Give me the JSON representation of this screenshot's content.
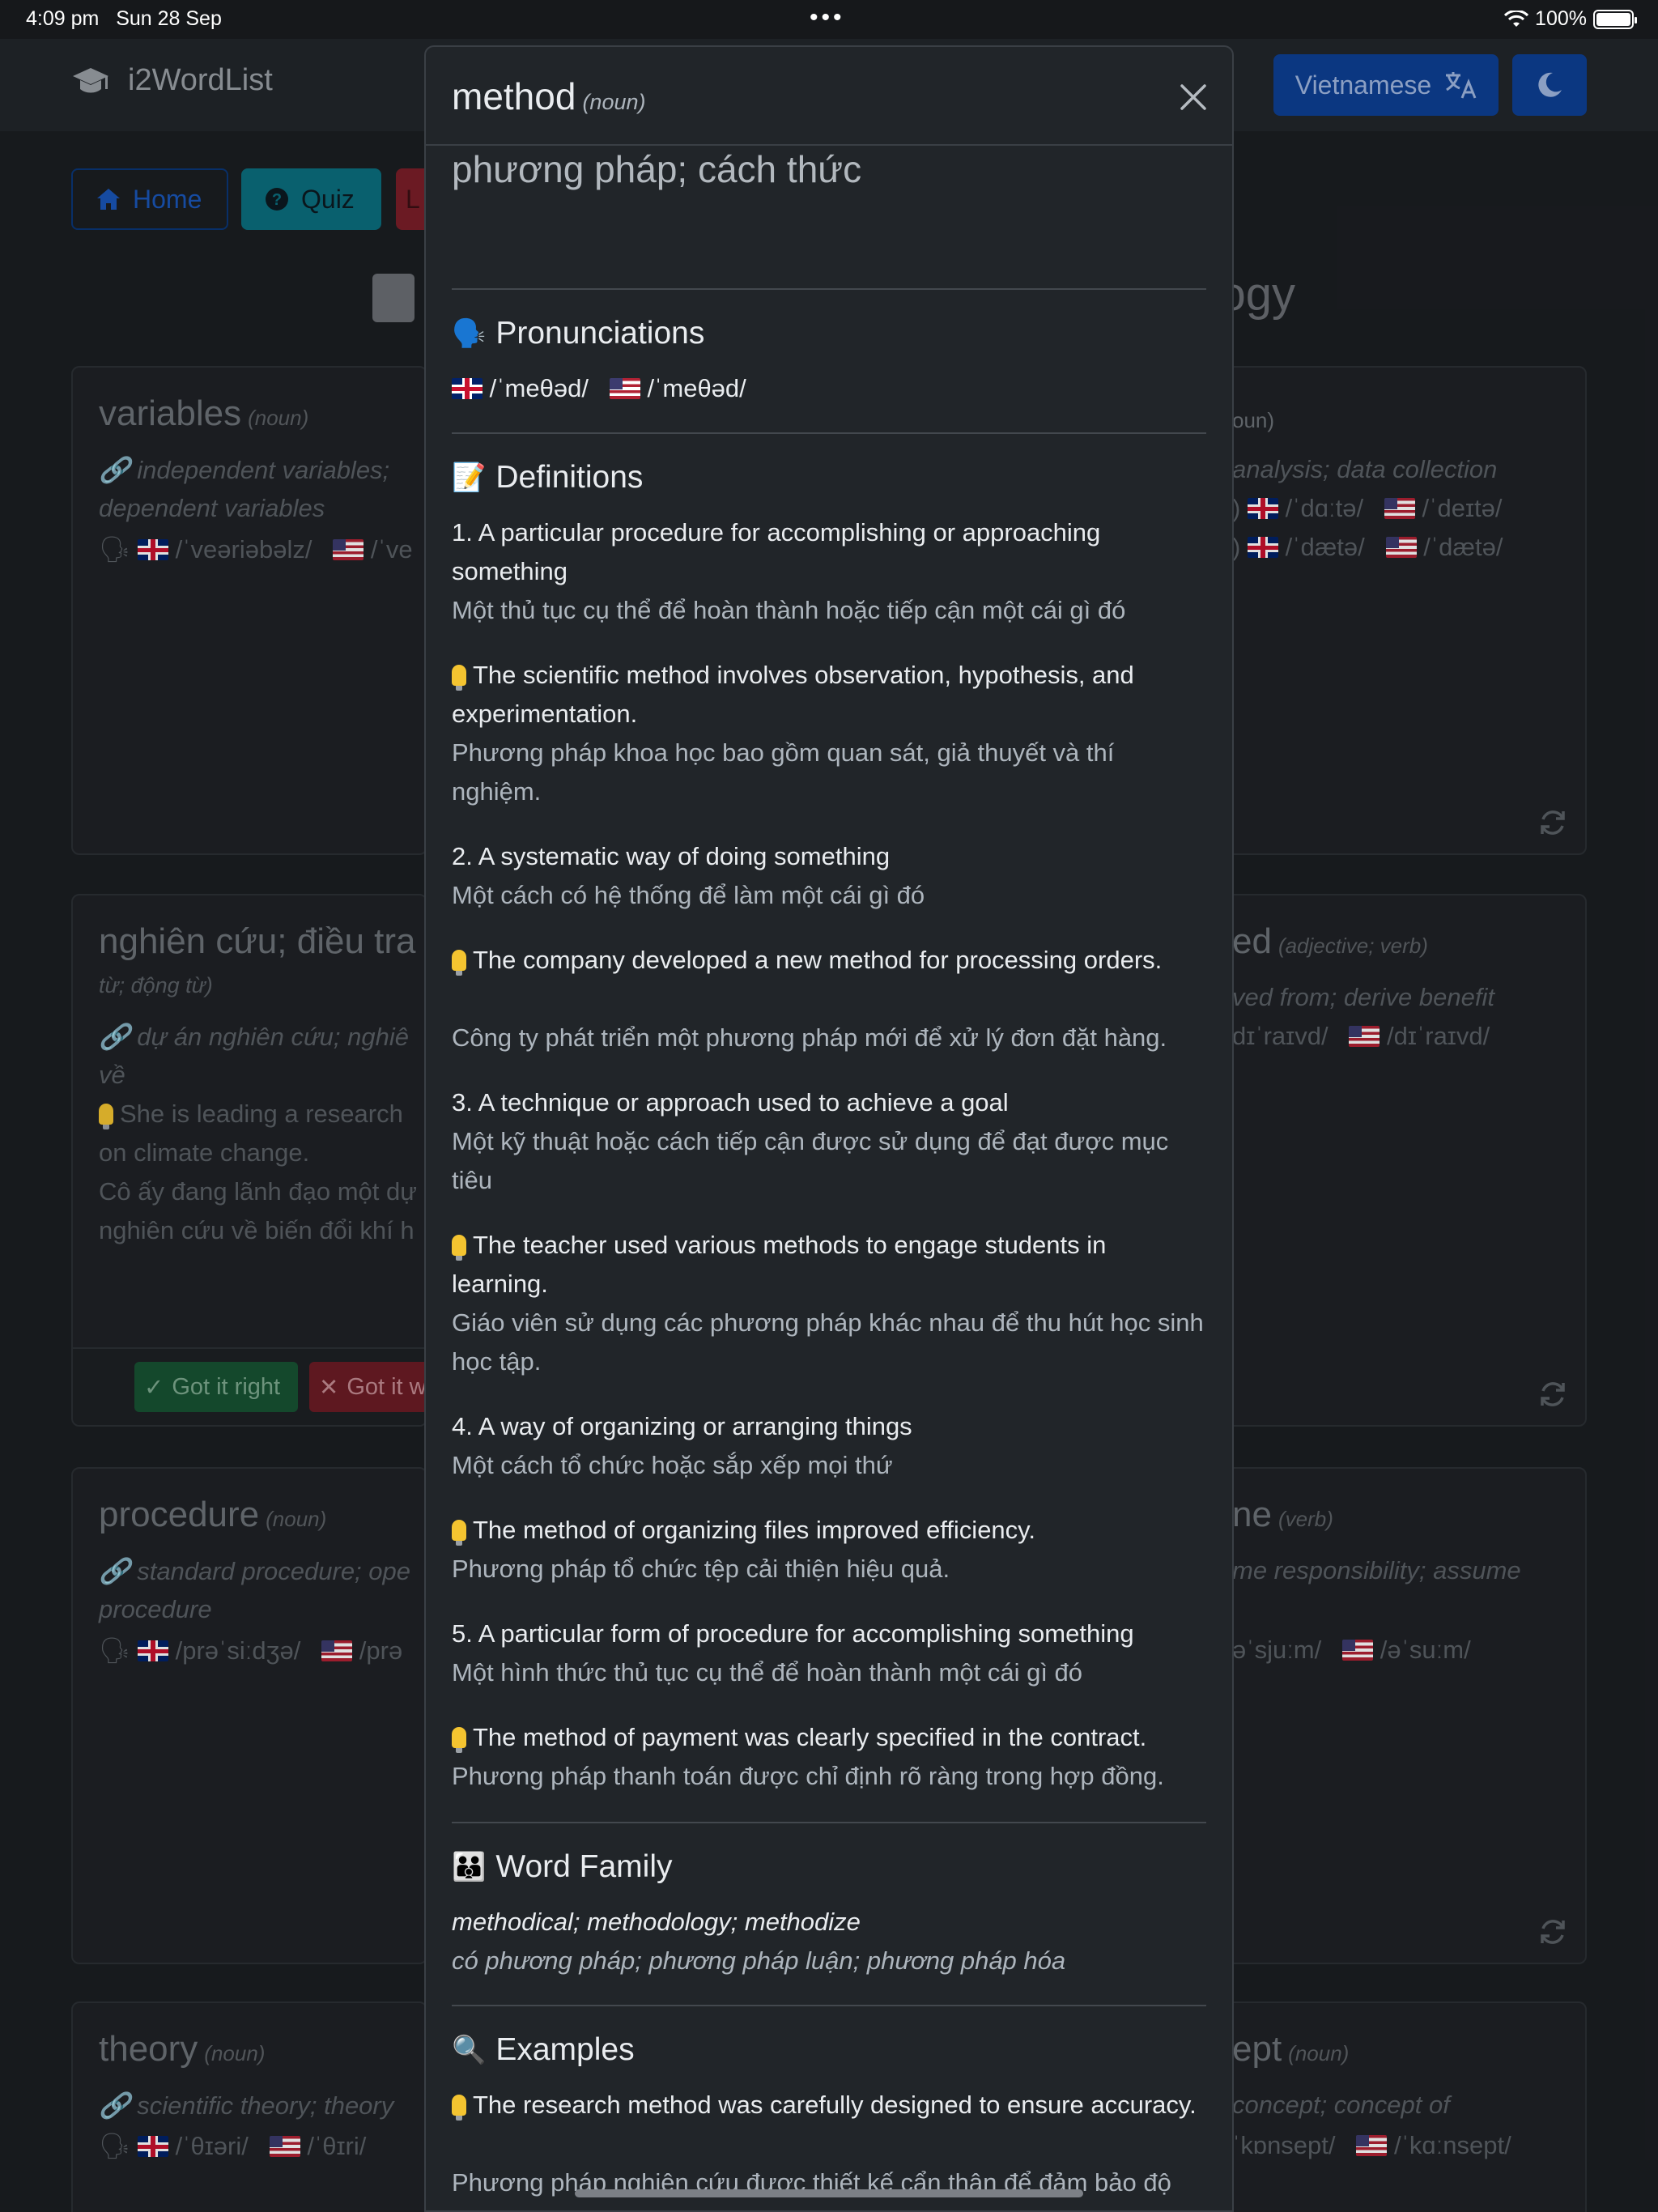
{
  "status_bar": {
    "time": "4:09 pm",
    "date": "Sun 28 Sep",
    "battery": "100%"
  },
  "navbar": {
    "brand": "i2WordList",
    "language_button": "Vietnamese"
  },
  "nav": {
    "home": "Home",
    "quiz": "Quiz",
    "third_initial": "L"
  },
  "page_heading_tail": "ogy",
  "cards": {
    "variables": {
      "word": "variables",
      "pos": "(noun)",
      "collocation": "independent variables;",
      "collocation2": "dependent variables",
      "pron": "/ˈveəriəbəlz/",
      "pron_us_partial": "/ˈve"
    },
    "data": {
      "pos": "oun)",
      "collocation": "analysis; data collection",
      "pron1_uk": "/ˈdɑːtə/",
      "pron1_us": "/ˈdeɪtə/",
      "pron2_uk": "/ˈdætə/",
      "pron2_us": "/ˈdætə/"
    },
    "research": {
      "word": "nghiên cứu; điều tra",
      "pos": "từ; động từ)",
      "collocation": "dự án nghiên cứu; nghiê",
      "collocation2": "về",
      "example": "She is leading a research",
      "example2": "on climate change.",
      "example_vi": "Cô ấy đang lãnh đạo một dự",
      "example_vi2": "nghiên cứu về biến đổi khí h",
      "ok": "Got it right",
      "bad": "Got it w"
    },
    "derived": {
      "word_tail": "ed",
      "pos": "(adjective; verb)",
      "collocation": "ved from; derive benefit",
      "pron_uk": "dɪˈraɪvd/",
      "pron_us": "/dɪˈraɪvd/"
    },
    "procedure": {
      "word": "procedure",
      "pos": "(noun)",
      "collocation": "standard procedure; ope",
      "collocation2": "procedure",
      "pron": "/prəˈsiːdʒə/",
      "pron_us_partial": "/prə"
    },
    "assume": {
      "word_tail": "ne",
      "pos": "(verb)",
      "collocation": "me responsibility; assume",
      "pron_uk": "əˈsjuːm/",
      "pron_us": "/əˈsuːm/"
    },
    "theory": {
      "word": "theory",
      "pos": "(noun)",
      "collocation": "scientific theory; theory",
      "pron": "/ˈθɪəri/",
      "pron_us": "/ˈθɪri/"
    },
    "concept": {
      "word_tail": "ept",
      "pos": "(noun)",
      "collocation": "concept; concept of",
      "pron_uk": "ˈkɒnsept/",
      "pron_us": "/ˈkɑːnsept/"
    }
  },
  "modal": {
    "word": "method",
    "pos": "(noun)",
    "translation": "phương pháp; cách thức",
    "pronunciations_title": "Pronunciations",
    "pron_uk": "/ˈmeθəd/",
    "pron_us": "/ˈmeθəd/",
    "definitions_title": "Definitions",
    "definitions": [
      {
        "en": "1. A particular procedure for accomplishing or approaching something",
        "vi": "Một thủ tục cụ thể để hoàn thành hoặc tiếp cận một cái gì đó",
        "ex": "The scientific method involves observation, hypothesis, and experimentation.",
        "ex_vi": "Phương pháp khoa học bao gồm quan sát, giả thuyết và thí nghiệm."
      },
      {
        "en": "2. A systematic way of doing something",
        "vi": "Một cách có hệ thống để làm một cái gì đó",
        "ex": "The company developed a new method for processing orders.",
        "ex_vi": "Công ty phát triển một phương pháp mới để xử lý đơn đặt hàng."
      },
      {
        "en": "3. A technique or approach used to achieve a goal",
        "vi": "Một kỹ thuật hoặc cách tiếp cận được sử dụng để đạt được mục tiêu",
        "ex": "The teacher used various methods to engage students in learning.",
        "ex_vi": "Giáo viên sử dụng các phương pháp khác nhau để thu hút học sinh học tập."
      },
      {
        "en": "4. A way of organizing or arranging things",
        "vi": "Một cách tổ chức hoặc sắp xếp mọi thứ",
        "ex": "The method of organizing files improved efficiency.",
        "ex_vi": "Phương pháp tổ chức tệp cải thiện hiệu quả."
      },
      {
        "en": "5. A particular form of procedure for accomplishing something",
        "vi": "Một hình thức thủ tục cụ thể để hoàn thành một cái gì đó",
        "ex": "The method of payment was clearly specified in the contract.",
        "ex_vi": "Phương pháp thanh toán được chỉ định rõ ràng trong hợp đồng."
      }
    ],
    "word_family_title": "Word Family",
    "word_family": "methodical; methodology; methodize",
    "word_family_vi": "có phương pháp; phương pháp luận; phương pháp hóa",
    "examples_title": "Examples",
    "example": "The research method was carefully designed to ensure accuracy.",
    "example_vi": "Phương pháp nghiên cứu được thiết kế cẩn thận để đảm bảo độ chính xác."
  }
}
